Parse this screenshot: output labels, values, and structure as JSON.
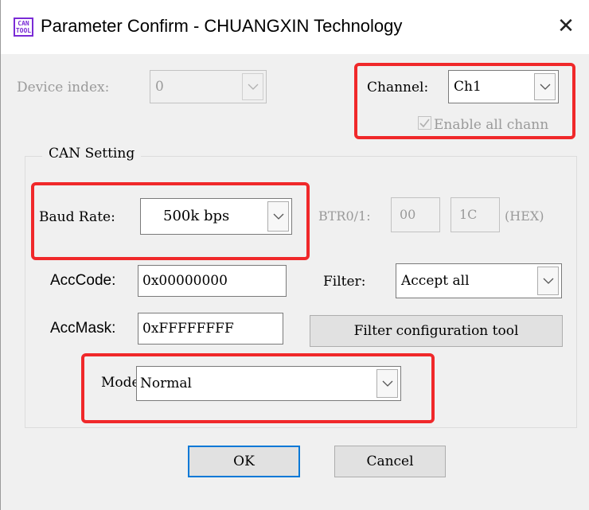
{
  "window": {
    "title": "Parameter Confirm - CHUANGXIN Technology",
    "app_icon_text": [
      "CAN",
      "TOOL"
    ],
    "close_glyph": "✕"
  },
  "device": {
    "label": "Device index:",
    "value": "0"
  },
  "channel": {
    "label": "Channel:",
    "value": "Ch1",
    "enable_all_label": "Enable all chann"
  },
  "can_setting": {
    "group_title": "CAN Setting",
    "baud_label": "Baud Rate:",
    "baud_value": "500k bps",
    "btr_label": "BTR0/1:",
    "btr0": "00",
    "btr1": "1C",
    "hex_label": "(HEX)",
    "acc_code_label": "AccCode:",
    "acc_code_value": "0x00000000",
    "filter_label": "Filter:",
    "filter_value": "Accept all",
    "acc_mask_label": "AccMask:",
    "acc_mask_value": "0xFFFFFFFF",
    "filter_tool_label": "Filter configuration tool",
    "mode_label": "Mode",
    "mode_value": "Normal"
  },
  "buttons": {
    "ok": "OK",
    "cancel": "Cancel"
  },
  "colors": {
    "highlight": "#f0282a",
    "default_button_border": "#0078d7",
    "icon_purple": "#7a2bd6"
  }
}
